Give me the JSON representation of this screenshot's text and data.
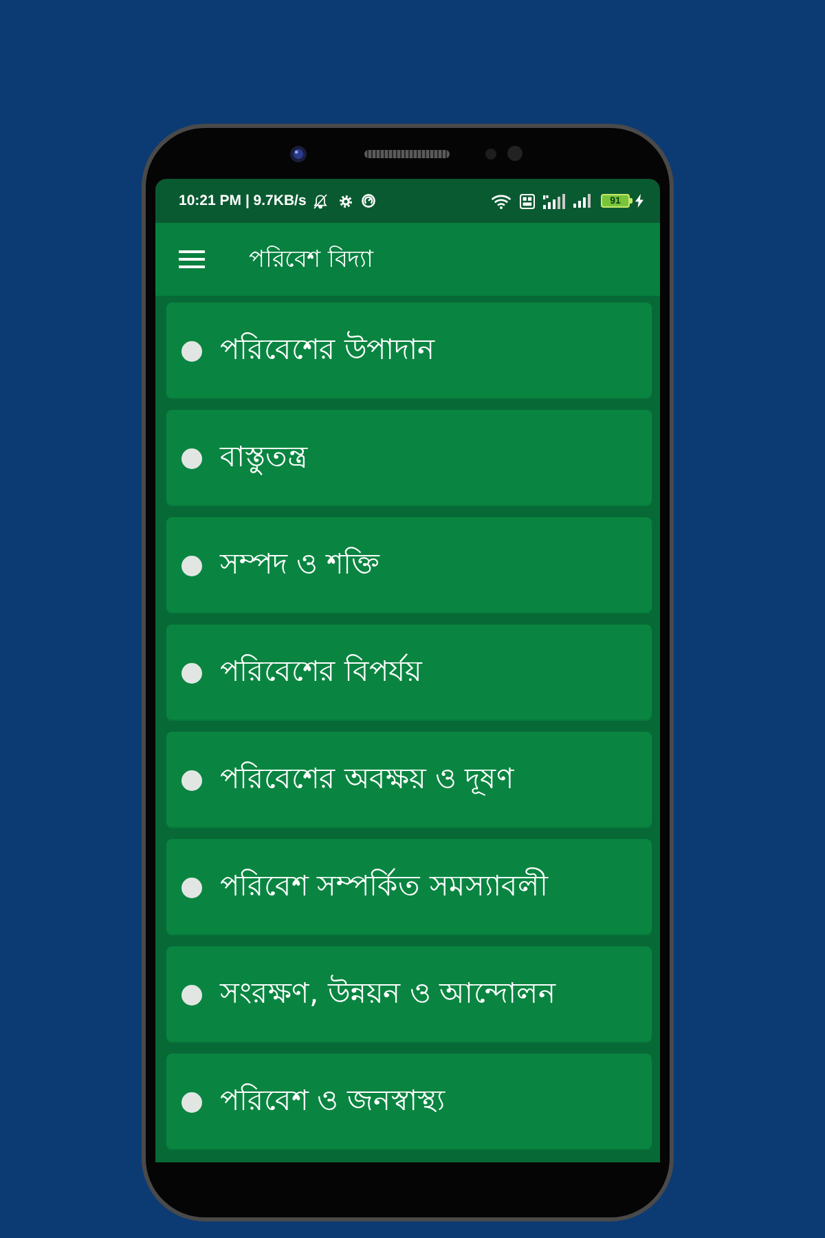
{
  "status_bar": {
    "text": "10:21 PM | 9.7KB/s",
    "battery": "91"
  },
  "app_bar": {
    "title": "পরিবেশ বিদ্যা"
  },
  "topics": [
    {
      "label": "পরিবেশের উপাদান"
    },
    {
      "label": "বাস্তুতন্ত্র"
    },
    {
      "label": "সম্পদ ও শক্তি"
    },
    {
      "label": "পরিবেশের বিপর্যয়"
    },
    {
      "label": "পরিবেশের অবক্ষয় ও দূষণ"
    },
    {
      "label": "পরিবেশ সম্পর্কিত সমস্যাবলী"
    },
    {
      "label": "সংরক্ষণ, উন্নয়ন ও আন্দোলন"
    },
    {
      "label": "পরিবেশ ও জনস্বাস্থ্য"
    }
  ]
}
